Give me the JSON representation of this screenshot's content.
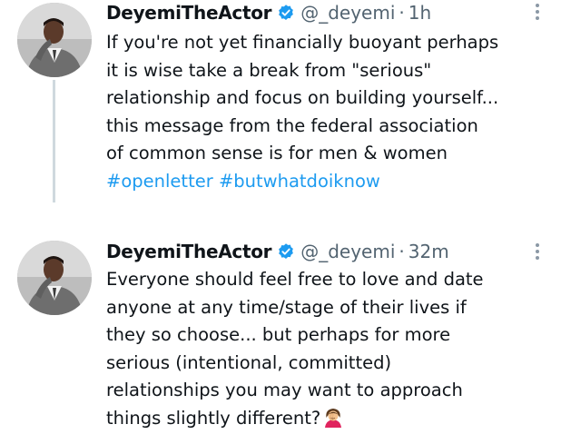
{
  "tweets": [
    {
      "display_name": "DeyemiTheActor",
      "handle": "@_deyemi",
      "separator": "·",
      "time": "1h",
      "lines": [
        "If you're not yet financially buoyant perhaps",
        "it is wise take a break from \"serious\"",
        "relationship and focus on building yourself...",
        "this message from the federal association",
        "of common sense is for men & women"
      ],
      "hashtags": [
        "#openletter",
        "#butwhatdoiknow"
      ]
    },
    {
      "display_name": "DeyemiTheActor",
      "handle": "@_deyemi",
      "separator": "·",
      "time": "32m",
      "lines": [
        "Everyone should feel free to love and date",
        "anyone at any time/stage of their lives if",
        "they so choose... but perhaps for more",
        "serious (intentional, committed)",
        "relationships you may want to approach",
        "things slightly different?"
      ]
    }
  ],
  "icons": {
    "verified": "verified-badge-icon",
    "more": "more-options-icon",
    "emoji": "woman-facepalming-emoji-icon"
  },
  "colors": {
    "hashtag": "#1d9bf0",
    "verified": "#1d9bf0",
    "muted": "#536471",
    "text": "#0f1419",
    "thread_line": "#cfd9de"
  }
}
